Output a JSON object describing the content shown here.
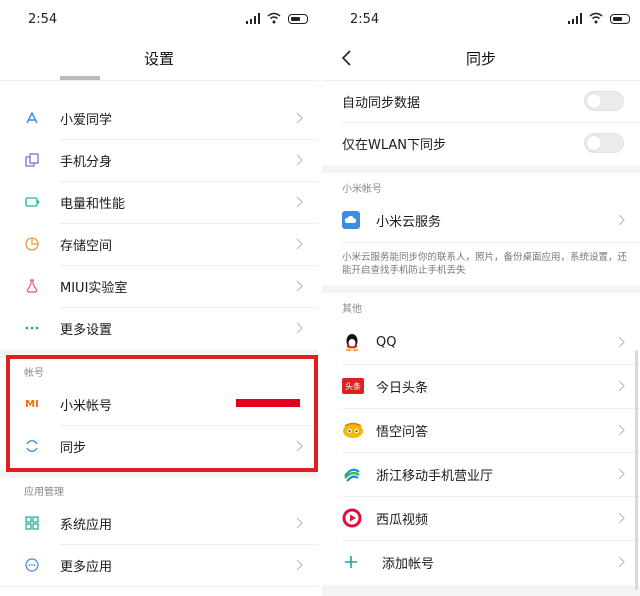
{
  "left": {
    "status": {
      "time": "2:54"
    },
    "title": "设置",
    "items": [
      {
        "label": "小爱同学",
        "icon": "xiaoai-icon"
      },
      {
        "label": "手机分身",
        "icon": "clone-icon"
      },
      {
        "label": "电量和性能",
        "icon": "battery-icon"
      },
      {
        "label": "存储空间",
        "icon": "storage-pie-icon"
      },
      {
        "label": "MIUI实验室",
        "icon": "flask-icon"
      },
      {
        "label": "更多设置",
        "icon": "more-dots-icon"
      }
    ],
    "account_section": "帐号",
    "account_items": [
      {
        "label": "小米帐号",
        "icon": "mi-logo-icon",
        "icon_text": "MI"
      },
      {
        "label": "同步",
        "icon": "sync-icon"
      }
    ],
    "apps_section": "应用管理",
    "apps_items": [
      {
        "label": "系统应用",
        "icon": "grid-icon"
      },
      {
        "label": "更多应用",
        "icon": "more-circle-icon"
      }
    ]
  },
  "right": {
    "status": {
      "time": "2:54"
    },
    "title": "同步",
    "toggles": [
      {
        "label": "自动同步数据",
        "on": false
      },
      {
        "label": "仅在WLAN下同步",
        "on": false
      }
    ],
    "mi_section": "小米帐号",
    "cloud": {
      "label": "小米云服务",
      "icon": "cloud-icon"
    },
    "cloud_desc": "小米云服务能同步你的联系人，照片，备份桌面应用，系统设置，还能开启查找手机防止手机丢失",
    "other_section": "其他",
    "other_items": [
      {
        "label": "QQ",
        "icon": "qq-icon"
      },
      {
        "label": "今日头条",
        "icon": "toutiao-icon",
        "icon_text": "头条"
      },
      {
        "label": "悟空问答",
        "icon": "wukong-icon"
      },
      {
        "label": "浙江移动手机营业厅",
        "icon": "china-mobile-icon"
      },
      {
        "label": "西瓜视频",
        "icon": "xigua-icon"
      }
    ],
    "add_account": "添加帐号"
  },
  "colors": {
    "accent": "#23a39a",
    "highlight": "#e02020",
    "mi_orange": "#ff6700"
  }
}
